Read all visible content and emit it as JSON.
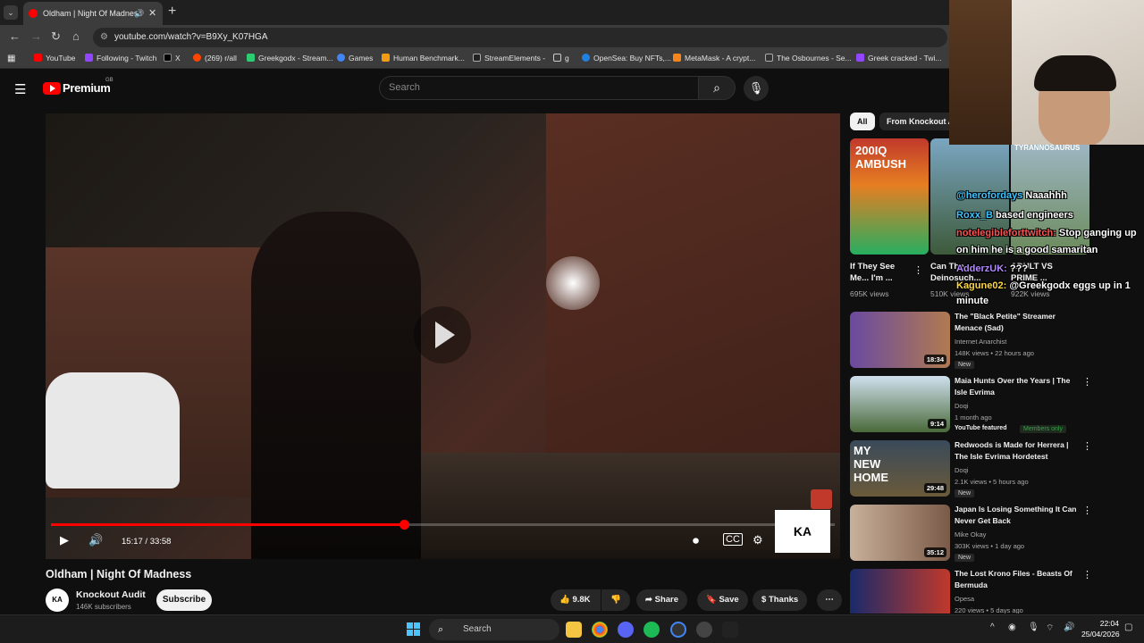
{
  "browser": {
    "tab_title": "Oldham | Night Of Madness",
    "url": "youtube.com/watch?v=B9Xy_K07HGA",
    "bookmarks": [
      "YouTube",
      "Following - Twitch",
      "X",
      "(269) r/all",
      "Greekgodx - Stream...",
      "Games",
      "Human Benchmark...",
      "StreamElements -",
      "g",
      "OpenSea: Buy NFTs,...",
      "MetaMask - A crypt...",
      "The Osbournes - Se...",
      "Greek cracked - Twi..."
    ]
  },
  "youtube": {
    "logo_text": "Premium",
    "country": "GB",
    "search_placeholder": "Search"
  },
  "player": {
    "current_time": "15:17",
    "duration": "33:58",
    "time_display": "15:17 / 33:58",
    "progress_fraction": 0.45,
    "overlay_logo": "KA"
  },
  "video": {
    "title": "Oldham | Night Of Madness",
    "channel": "Knockout Audit",
    "channel_avatar": "KA",
    "subscribers": "146K subscribers",
    "subscribe_label": "Subscribe",
    "likes": "9.8K",
    "share_label": "Share",
    "save_label": "Save",
    "thanks_label": "Thanks"
  },
  "chips": [
    "All",
    "From Knockout A"
  ],
  "shorts": [
    {
      "title": "If They See Me... I'm ...",
      "views": "695K views",
      "thumb_text": "200IQ AMBUSH"
    },
    {
      "title": "Can The Deinosuch...",
      "views": "510K views",
      "thumb_text": ""
    },
    {
      "title": "ADULT VS PRIME ...",
      "views": "922K views",
      "thumb_text": "TYRANNOSAURUS"
    }
  ],
  "recommendations": [
    {
      "title": "The \"Black Petite\" Streamer Menace (Sad)",
      "channel": "Internet Anarchist",
      "meta": "148K views • 22 hours ago",
      "duration": "18:34",
      "badge": "New"
    },
    {
      "title": "Maia Hunts Over the Years | The Isle Evrima",
      "channel": "Doqi",
      "meta": "1 month ago",
      "duration": "9:14",
      "badge": "YouTube featured",
      "extra": "Members only"
    },
    {
      "title": "Redwoods is Made for Herrera | The Isle Evrima Hordetest",
      "channel": "Doqi",
      "meta": "2.1K views • 5 hours ago",
      "duration": "29:48",
      "badge": "New",
      "thumb_text": "MY NEW HOME"
    },
    {
      "title": "Japan Is Losing Something It Can Never Get Back",
      "channel": "Mike Okay",
      "meta": "303K views • 1 day ago",
      "duration": "35:12",
      "badge": "New"
    },
    {
      "title": "The Lost Krono Files - Beasts Of Bermuda",
      "channel": "Opesa",
      "meta": "220 views • 5 days ago",
      "duration": "",
      "badge": ""
    }
  ],
  "chat": [
    {
      "user": "@herofordays",
      "text": "Naaahhh"
    },
    {
      "user": "Roxx_B",
      "text": "based engineers"
    },
    {
      "user": "notelegibleforttwitch:",
      "text": "Stop ganging up on him he is a good samaritan"
    },
    {
      "user": "AdderzUK:",
      "text": "???"
    },
    {
      "user": "Kagune02:",
      "text": "@Greekgodx eggs up in 1 minute"
    }
  ],
  "taskbar": {
    "search_label": "Search",
    "time": "22:04",
    "date": "25/04/2026"
  },
  "colors": {
    "accent": "#ff0000",
    "background": "#0f0f0f"
  }
}
